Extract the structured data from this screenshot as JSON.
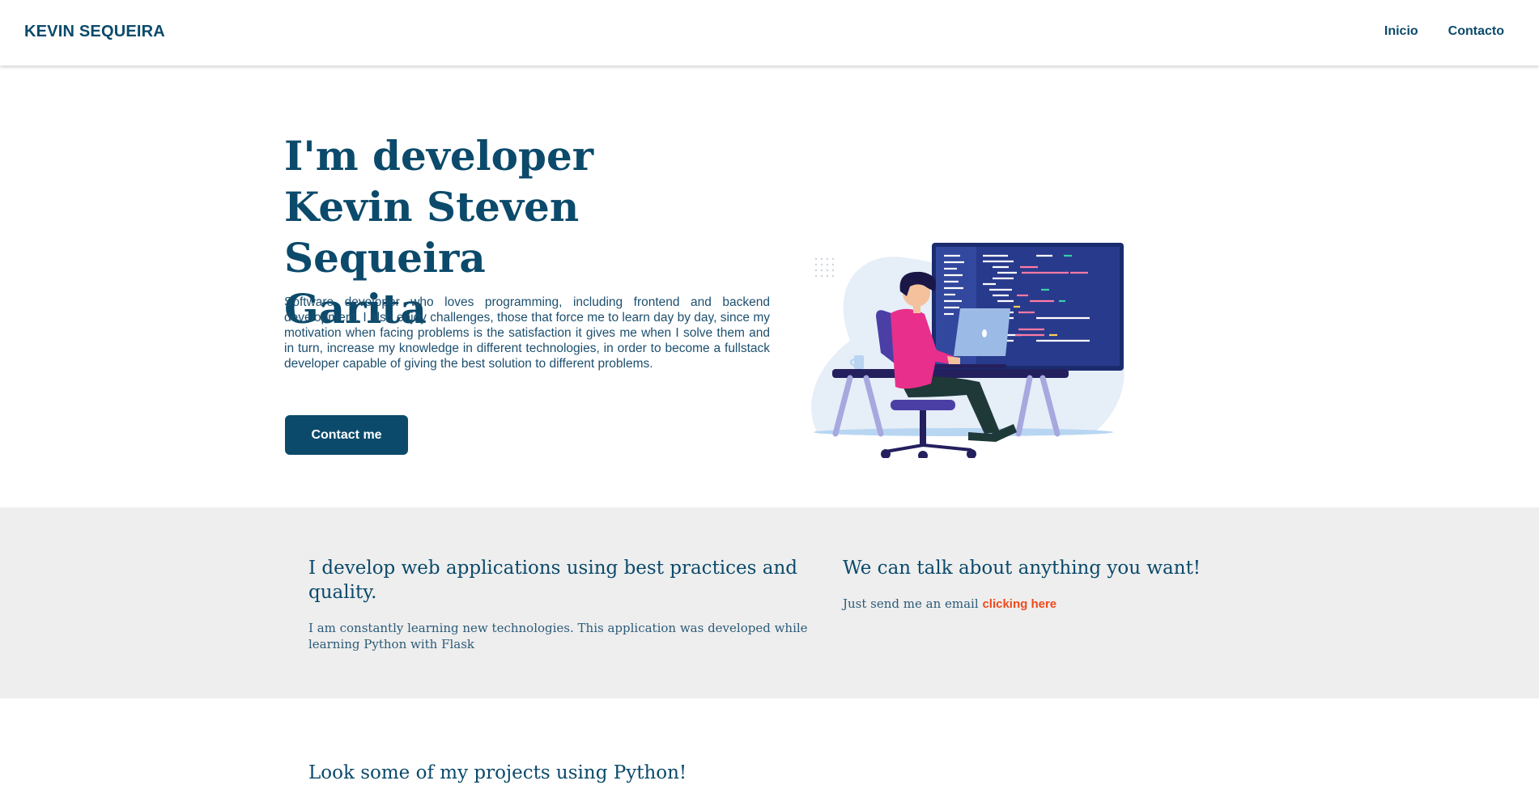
{
  "navbar": {
    "brand": "KEVIN SEQUEIRA",
    "links": [
      "Inicio",
      "Contacto"
    ]
  },
  "hero": {
    "title_lines": [
      "I'm developer",
      "Kevin Steven Sequeira",
      "Garita"
    ],
    "description": "Software developer who loves programming, including frontend and backend development, I also enjoy challenges, those that force me to learn day by day, since my motivation when facing problems is the satisfaction it gives me when I solve them and in turn, increase my knowledge in different technologies, in order to become a fullstack developer capable of giving the best solution to different problems.",
    "button_label": "Contact me",
    "illustration_icon": "developer-at-desk-illustration"
  },
  "info": {
    "left_heading": "I develop web applications using best practices and quality.",
    "left_text": "I am constantly learning new technologies. This application was developed while learning Python with Flask",
    "right_heading": "We can talk about anything you want!",
    "right_text": "Just send me an email",
    "right_link": "clicking here"
  },
  "projects": {
    "heading": "Look some of my projects using Python!"
  },
  "colors": {
    "primary": "#0b4a6b",
    "accent": "#ef4a1b",
    "band_background": "#eeeeee",
    "monitor": "#283a8c",
    "shirt": "#e82f8b"
  }
}
